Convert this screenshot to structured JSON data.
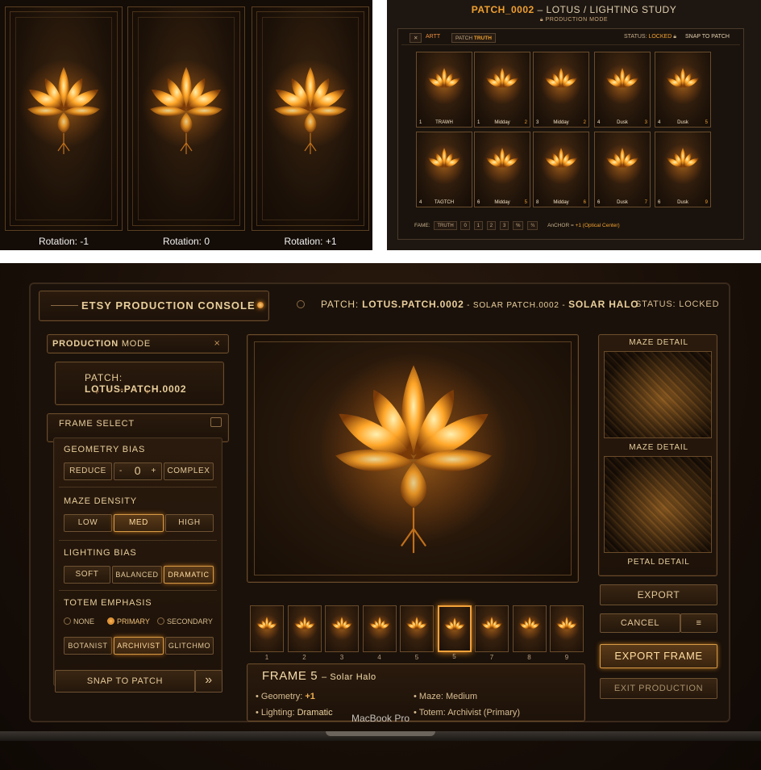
{
  "rotations": {
    "labels": [
      "Rotation: -1",
      "Rotation: 0",
      "Rotation: +1"
    ]
  },
  "patch_grid": {
    "title_highlight": "PATCH_0002",
    "title_rest": " – LOTUS / LIGHTING STUDY",
    "subtitle": "PRODUCTION MODE",
    "close_label": "✕",
    "tab_art": "ARTT",
    "tab_patch_a": "PATCH ",
    "tab_patch_b": "TRUTH",
    "status_label": "STATUS: ",
    "status_value": "LOCKED",
    "snap_label": "SNAP TO PATCH",
    "thumbs": [
      {
        "left": "1",
        "mid": "TRAWH",
        "right": ""
      },
      {
        "left": "1",
        "mid": "Midday",
        "right": "2"
      },
      {
        "left": "3",
        "mid": "Midday",
        "right": "2"
      },
      {
        "left": "4",
        "mid": "Dusk",
        "right": "3"
      },
      {
        "left": "4",
        "mid": "Dusk",
        "right": "5"
      },
      {
        "left": "4",
        "mid": "TAGTCH",
        "right": ""
      },
      {
        "left": "6",
        "mid": "Midday",
        "right": "5"
      },
      {
        "left": "8",
        "mid": "Midday",
        "right": "6"
      },
      {
        "left": "6",
        "mid": "Dusk",
        "right": "7"
      },
      {
        "left": "6",
        "mid": "Dusk",
        "right": "9"
      }
    ],
    "footer_label": "FAME:",
    "footer_buttons": [
      "TRUTH",
      "0",
      "1",
      "2",
      "3",
      "%",
      "¾"
    ],
    "footer_anchor_label": "AnCHOR = ",
    "footer_anchor_value": "+1 (Optical Center)"
  },
  "console": {
    "app_title": "ETSY PRODUCTION CONSOLE",
    "patch_prefix": "PATCH: ",
    "patch_name": "LOTUS.PATCH.0002",
    "patch_mid": " - SOLAR PATCH.0002 - ",
    "patch_suffix": "SOLAR HALO",
    "status": "STATUS: LOCKED",
    "production_mode_a": "PRODUCTION ",
    "production_mode_b": "MODE",
    "patch_box_prefix": "PATCH: ",
    "patch_box_value": "LOTUS.PATCH.0002",
    "frame_select": "FRAME SELECT",
    "geometry_bias": "GEOMETRY BIAS",
    "reduce": "REDUCE",
    "minus": "-",
    "geometry_value": "0",
    "plus": "+",
    "complex": "COMPLEX",
    "maze_density": "MAZE DENSITY",
    "low": "LOW",
    "med": "MED",
    "high": "HIGH",
    "lighting_bias": "LIGHTING BIAS",
    "soft": "SOFT",
    "balanced": "BALANCED",
    "dramatic": "DRAMATIC",
    "totem_emphasis": "TOTEM EMPHASIS",
    "none": "NONE",
    "primary": "PRIMARY",
    "secondary": "SECONDARY",
    "botanist": "BOTANIST",
    "archivist": "ARCHIVIST",
    "glitchmo": "GLITCHMO",
    "snap_to_patch": "SNAP TO PATCH",
    "snap_arrow": "»",
    "frame_numbers": [
      "1",
      "2",
      "3",
      "4",
      "5",
      "5",
      "7",
      "8",
      "9"
    ],
    "selected_frame_index": 5,
    "frame_title": "FRAME 5",
    "frame_subtitle": "– Solar Halo",
    "geometry_label": "Geometry: ",
    "geometry_val": "+1",
    "lighting_label": "Lighting: ",
    "lighting_val": "Dramatic",
    "maze_label": "Maze: ",
    "maze_val": "Medium",
    "totem_label": "Totem: ",
    "totem_val": "Archivist (Primary)",
    "maze_detail_top": "MAZE DETAIL",
    "maze_detail_mid": "MAZE DETAIL",
    "petal_detail": "PETAL DETAIL",
    "export": "EXPORT",
    "cancel": "CANCEL",
    "export_frame": "EXPORT FRAME",
    "exit_production": "EXIT PRODUCTION"
  },
  "device_label": "MacBook Pro",
  "colors": {
    "accent": "#f0a030",
    "panel": "#1d1209",
    "border": "#6a4b2a"
  }
}
